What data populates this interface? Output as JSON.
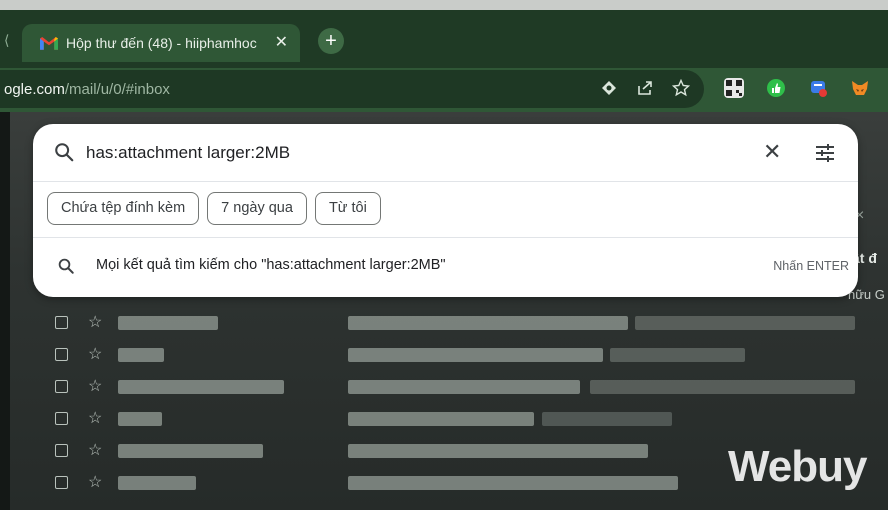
{
  "browser": {
    "tab": {
      "title": "Hộp thư đến (48) - hiiphamhoc",
      "close_glyph": "✕"
    },
    "tab_edge_glyph": "⟨",
    "new_tab_glyph": "+",
    "address": {
      "host": "ogle.com",
      "path": "/mail/u/0/#inbox"
    },
    "omnibox_icons": [
      "eye-hide-icon",
      "share-icon",
      "star-icon"
    ],
    "extensions": [
      "qr-code-extension-icon",
      "thumbs-up-extension-icon",
      "blue-extension-icon",
      "metamask-fox-icon"
    ]
  },
  "search": {
    "query": "has:attachment larger:2MB",
    "clear_glyph": "✕",
    "chips": [
      {
        "label": "Chứa tệp đính kèm"
      },
      {
        "label": "7 ngày qua"
      },
      {
        "label": "Từ tôi"
      }
    ],
    "suggestion": {
      "text": "Mọi kết quả tìm kiếm cho \"has:attachment larger:2MB\"",
      "hint": "Nhấn ENTER"
    }
  },
  "background": {
    "fragment_right_top": "ật đ",
    "fragment_right_bottom": "hữu G",
    "close_glyph": "×",
    "star_glyph": "☆"
  },
  "watermark": "Webuy",
  "colors": {
    "tabbar": "#1f3a25",
    "toolbar": "#2f5736",
    "panel": "#ffffff",
    "chip_border": "#747775"
  }
}
